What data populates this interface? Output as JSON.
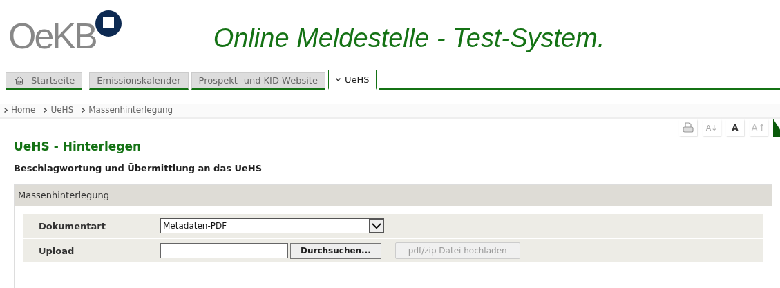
{
  "logo": {
    "text": "OeKB"
  },
  "site_title": "Online Meldestelle - Test-System.",
  "tabs": [
    {
      "label": "Startseite",
      "selected": false,
      "kind": "home"
    },
    {
      "label": "Emissionskalender",
      "selected": false,
      "kind": "plain"
    },
    {
      "label": "Prospekt- und KID-Website",
      "selected": false,
      "kind": "plain"
    },
    {
      "label": "UeHS",
      "selected": true,
      "kind": "plain"
    }
  ],
  "breadcrumb": [
    "Home",
    "UeHS",
    "Massenhinterlegung"
  ],
  "font_tools": [
    "A↓",
    "A",
    "A↑"
  ],
  "heading": "UeHS - Hinterlegen",
  "subheading": "Beschlagwortung und Übermittlung an das UeHS",
  "panel": {
    "title": "Massenhinterlegung",
    "dokumentart": {
      "label": "Dokumentart",
      "value": "Metadaten-PDF"
    },
    "upload": {
      "label": "Upload",
      "browse_button": "Durchsuchen...",
      "submit_button": {
        "label": "pdf/zip Datei hochladen",
        "disabled": true
      }
    }
  }
}
